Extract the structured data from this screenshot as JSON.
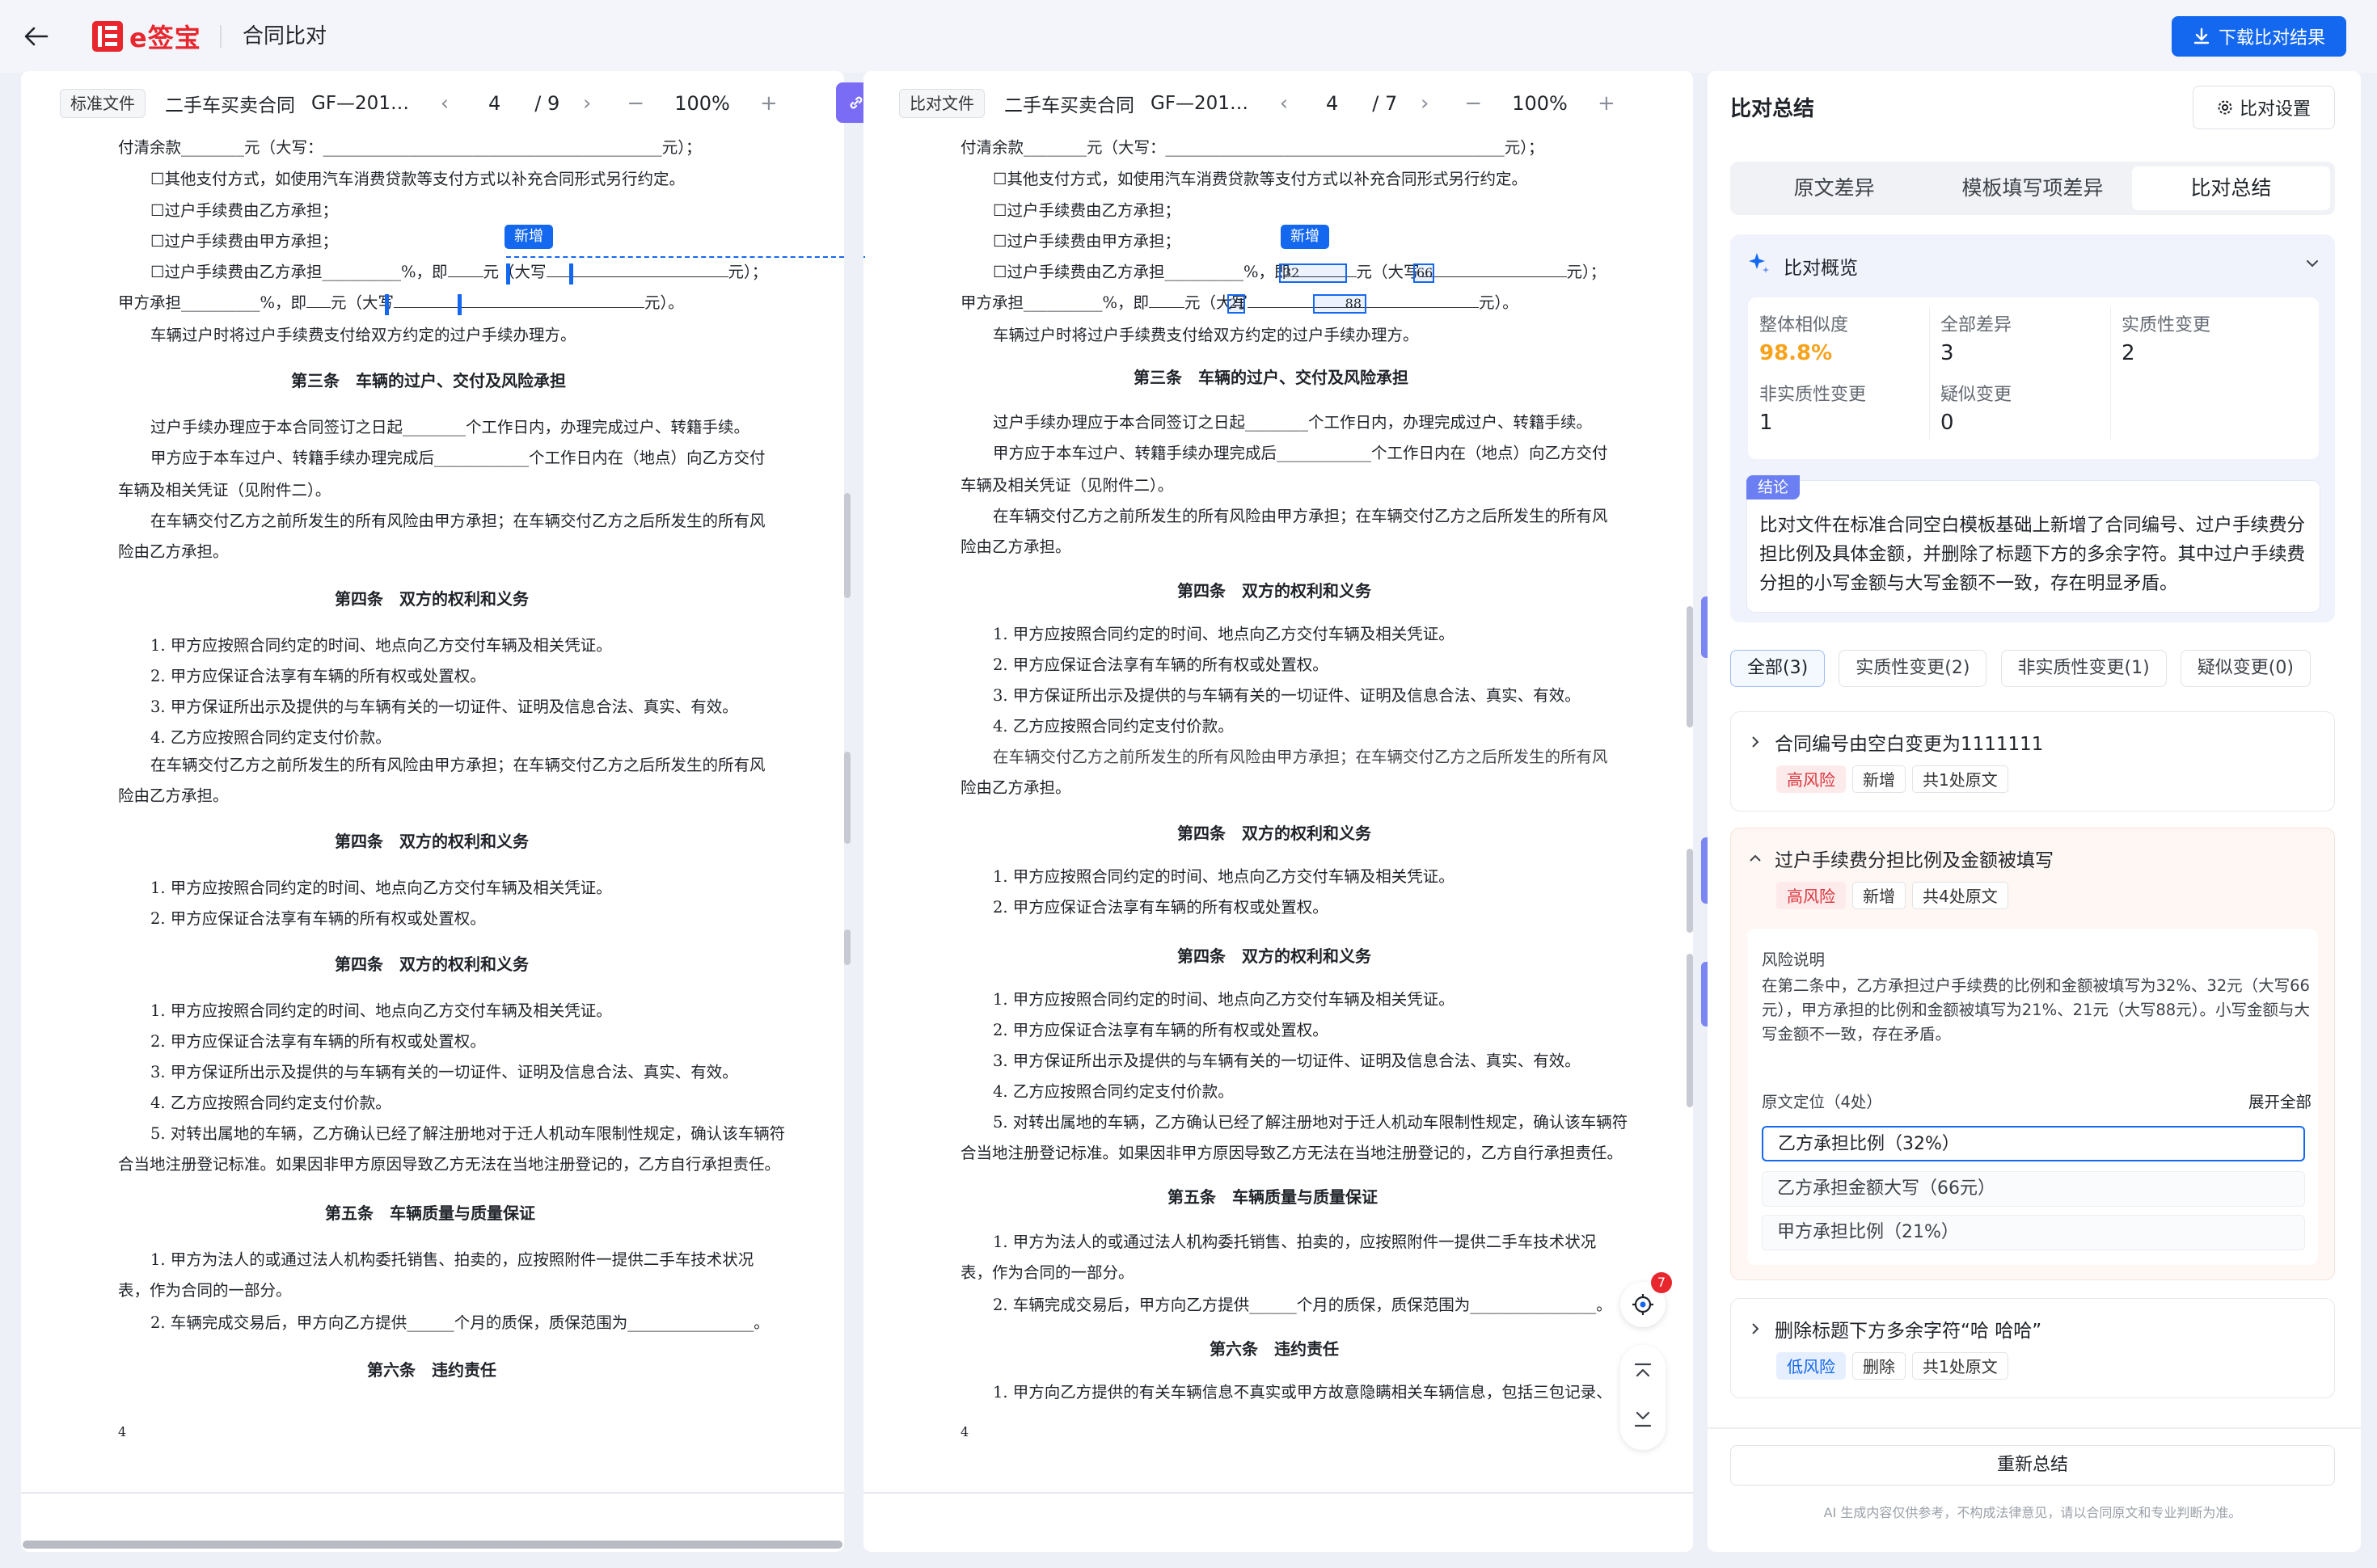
{
  "header": {
    "title": "合同比对",
    "logo_text": "e签宝",
    "download_label": "下载比对结果"
  },
  "left_doc": {
    "tag": "标准文件",
    "name": "二手车买卖合同",
    "code": "GF—201…",
    "page": "4",
    "total": "/ 9",
    "zoom": "100%"
  },
  "right_doc": {
    "tag": "比对文件",
    "name": "二手车买卖合同",
    "code": "GF—201…",
    "page": "4",
    "total": "/ 7",
    "zoom": "100%"
  },
  "badge_new": "新增",
  "left_text": {
    "l1": "付清余款________元（大写：___________________________________________元）；",
    "l2": "☐其他支付方式，如使用汽车消费贷款等支付方式以补充合同形式另行约定。",
    "l3": "☐过户手续费由乙方承担；",
    "l4": "☐过户手续费由甲方承担；",
    "l5": "☐过户手续费由乙方承担__________%，即",
    "l5b": "元（大写",
    "l5c": "元）；",
    "l6": "甲方承担__________%，即",
    "l6b": "元（大写",
    "l6c": "元）。",
    "l7": "车辆过户时将过户手续费支付给双方约定的过户手续办理方。",
    "h3": "第三条　车辆的过户、交付及风险承担",
    "p1": "过户手续办理应于本合同签订之日起________个工作日内，办理完成过户、转籍手续。",
    "p2": "甲方应于本车过户、转籍手续办理完成后____________个工作日内在（地点）向乙方交付",
    "p2b": "车辆及相关凭证（见附件二）。",
    "p3": "在车辆交付乙方之前所发生的所有风险由甲方承担；在车辆交付乙方之后所发生的所有风",
    "p3b": "险由乙方承担。",
    "h4": "第四条　双方的权利和义务",
    "r1": "1. 甲方应按照合同约定的时间、地点向乙方交付车辆及相关凭证。",
    "r2": "2. 甲方应保证合法享有车辆的所有权或处置权。",
    "r3": "3. 甲方保证所出示及提供的与车辆有关的一切证件、证明及信息合法、真实、有效。",
    "r4": "4. 乙方应按照合同约定支付价款。",
    "r5": "5. 对转出属地的车辆，乙方确认已经了解注册地对于迁人机动车限制性规定，确认该车辆符",
    "r5b": "合当地注册登记标准。如果因非甲方原因导致乙方无法在当地注册登记的，乙方自行承担责任。",
    "h5": "第五条　车辆质量与质量保证",
    "q1": "1. 甲方为法人的或通过法人机构委托销售、拍卖的，应按照附件一提供二手车技术状况",
    "q1b": "表，作为合同的一部分。",
    "q2": "2. 车辆完成交易后，甲方向乙方提供______个月的质保，质保范围为________________。",
    "h6": "第六条　违约责任",
    "s1": "1. 甲方向乙方提供的有关车辆信息不真实或甲方故意隐瞒相关车辆信息，包括三包记录、",
    "page_no": "4"
  },
  "right_vals": {
    "v1": "32",
    "v2": "66",
    "v3": "21",
    "v4": "88"
  },
  "summary": {
    "title": "比对总结",
    "settings_label": "比对设置",
    "tabs": [
      "原文差异",
      "模板填写项差异",
      "比对总结"
    ],
    "overview_title": "比对概览",
    "stats": [
      {
        "label": "整体相似度",
        "value": "98.8%"
      },
      {
        "label": "全部差异",
        "value": "3"
      },
      {
        "label": "实质性变更",
        "value": "2"
      },
      {
        "label": "非实质性变更",
        "value": "1"
      },
      {
        "label": "疑似变更",
        "value": "0"
      }
    ],
    "conclusion_tag": "结论",
    "conclusion": [
      "比对文件在标准合同空白模板基础上新增了合同编号、过户手续费分",
      "担比例及具体金额，并删除了标题下方的多余字符。其中过户手续费",
      "分担的小写金额与大写金额不一致，存在明显矛盾。"
    ],
    "filters": [
      "全部(3)",
      "实质性变更(2)",
      "非实质性变更(1)",
      "疑似变更(0)"
    ],
    "items": [
      {
        "title": "合同编号由空白变更为1111111",
        "risk": "高风险",
        "type": "新增",
        "count": "共1处原文"
      },
      {
        "title": "过户手续费分担比例及金额被填写",
        "risk": "高风险",
        "type": "新增",
        "count": "共4处原文"
      },
      {
        "title": "删除标题下方多余字符“哈 哈哈”",
        "risk": "低风险",
        "type": "删除",
        "count": "共1处原文"
      }
    ],
    "risk_label": "风险说明",
    "risk_desc": [
      "在第二条中，乙方承担过户手续费的比例和金额被填写为32%、32元（大写66",
      "元），甲方承担的比例和金额被填写为21%、21元（大写88元）。小写金额与大",
      "写金额不一致，存在矛盾。"
    ],
    "loc_label": "原文定位（4处）",
    "expand_all": "展开全部",
    "locs": [
      "乙方承担比例（32%）",
      "乙方承担金额大写（66元）",
      "甲方承担比例（21%）"
    ],
    "resummarize": "重新总结",
    "disclaimer": "AI 生成内容仅供参考，不构成法律意见，请以合同原文和专业判断为准。",
    "badge_count": "7"
  },
  "colors": {
    "primary": "#1468ef",
    "similarity": "#f7a21b",
    "risk_high": "#d9363e",
    "risk_low": "#1468ef"
  }
}
